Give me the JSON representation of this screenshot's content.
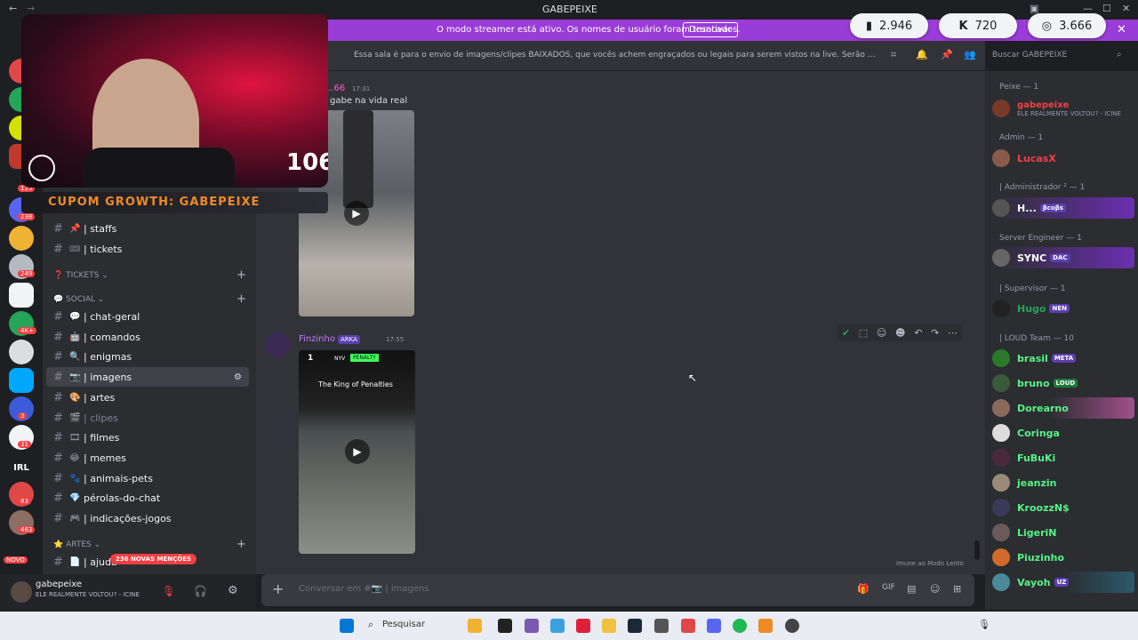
{
  "window": {
    "title": "GABEPEIXE"
  },
  "banner": {
    "text": "O modo streamer está ativo. Os nomes de usuário foram truncados.",
    "button": "Desativar"
  },
  "stats": {
    "twitch": "2.946",
    "kick": "720",
    "total": "3.666"
  },
  "server_rail": {
    "badges": [
      "125",
      "238",
      "249",
      "4K+",
      "3",
      "31",
      "83",
      "463"
    ],
    "novo": "NOVO",
    "irl": "IRL"
  },
  "channels": {
    "items": [
      {
        "emoji": "📌",
        "name": "| staffs"
      },
      {
        "emoji": "🎟",
        "name": "| tickets"
      }
    ],
    "cat_tickets": "TICKETS",
    "cat_social": "SOCIAL",
    "social": [
      {
        "emoji": "💬",
        "name": "| chat-geral"
      },
      {
        "emoji": "🤖",
        "name": "| comandos"
      },
      {
        "emoji": "🔍",
        "name": "| enigmas"
      },
      {
        "emoji": "📷",
        "name": "| imagens"
      },
      {
        "emoji": "🎨",
        "name": "| artes"
      },
      {
        "emoji": "🎬",
        "name": "| clipes"
      },
      {
        "emoji": "🎞",
        "name": "| filmes"
      },
      {
        "emoji": "😂",
        "name": "| memes"
      },
      {
        "emoji": "🐾",
        "name": "| animais-pets"
      },
      {
        "emoji": "💎",
        "name": "pérolas-do-chat"
      },
      {
        "emoji": "🎮",
        "name": "| indicações-jogos"
      }
    ],
    "cat_artes": "ARTES",
    "last": "| ajuda",
    "mentions": "236 NOVAS MENÇÕES"
  },
  "user": {
    "name": "gabepeixe",
    "status": "ELE REALMENTE VOLTOU? - ICINE"
  },
  "chat": {
    "topic": "Essa sala é para o envio de imagens/clipes BAIXADOS, que vocês achem engraçados ou legais para serem vistos na live. Serão apagados prints de o...",
    "search_placeholder": "Buscar GABEPEIXE",
    "msg1": {
      "author": "...66",
      "time": "17:31",
      "text": "gabe na vida real"
    },
    "msg2": {
      "author": "Finzinho",
      "tag": "ARKA",
      "time": "17:55",
      "video_caption": "The King of Penalties",
      "video_rank": "1",
      "video_team": "NYV",
      "video_badge": "PENALTY"
    },
    "slowmode": "Imune ao Modo Lento",
    "composer_placeholder": "Conversar em #📷 | imagens"
  },
  "members": {
    "groups": [
      {
        "role": "Peixe — 1",
        "members": [
          {
            "name": "gabepeixe",
            "sub": "ELE REALMENTE VOLTOU? - ICINE",
            "color": "#f23f43"
          }
        ]
      },
      {
        "role": "Admin — 1",
        "members": [
          {
            "name": "LucasX",
            "color": "#f23f43"
          }
        ]
      },
      {
        "role": "| Administrador ² — 1",
        "members": [
          {
            "name": "H...",
            "tag": "βcoβs",
            "color": "#ffffff"
          }
        ]
      },
      {
        "role": "Server Engineer — 1",
        "members": [
          {
            "name": "SYNC",
            "tag": "DAC",
            "color": "#ffffff"
          }
        ]
      },
      {
        "role": "| Supervisor — 1",
        "members": [
          {
            "name": "Hugo",
            "tag": "NEN",
            "color": "#23a55a"
          }
        ]
      },
      {
        "role": "| LOUD Team — 10",
        "members": [
          {
            "name": "brasil",
            "tag": "META",
            "color": "#57f287"
          },
          {
            "name": "bruno",
            "tag": "LOUD",
            "color": "#57f287"
          },
          {
            "name": "Dorearno",
            "color": "#57f287"
          },
          {
            "name": "Coringa",
            "color": "#57f287"
          },
          {
            "name": "FuBuKi",
            "color": "#57f287"
          },
          {
            "name": "jeanzin",
            "color": "#57f287"
          },
          {
            "name": "KroozzN$",
            "color": "#57f287"
          },
          {
            "name": "LigeriN",
            "color": "#57f287"
          },
          {
            "name": "Piuzinho",
            "color": "#57f287"
          },
          {
            "name": "Vayoh",
            "tag": "UZ",
            "color": "#57f287"
          }
        ]
      }
    ]
  },
  "overlay": {
    "cam_number": "106",
    "coupon": "CUPOM GROWTH: GABEPEIXE"
  },
  "taskbar": {
    "search": "Pesquisar"
  }
}
